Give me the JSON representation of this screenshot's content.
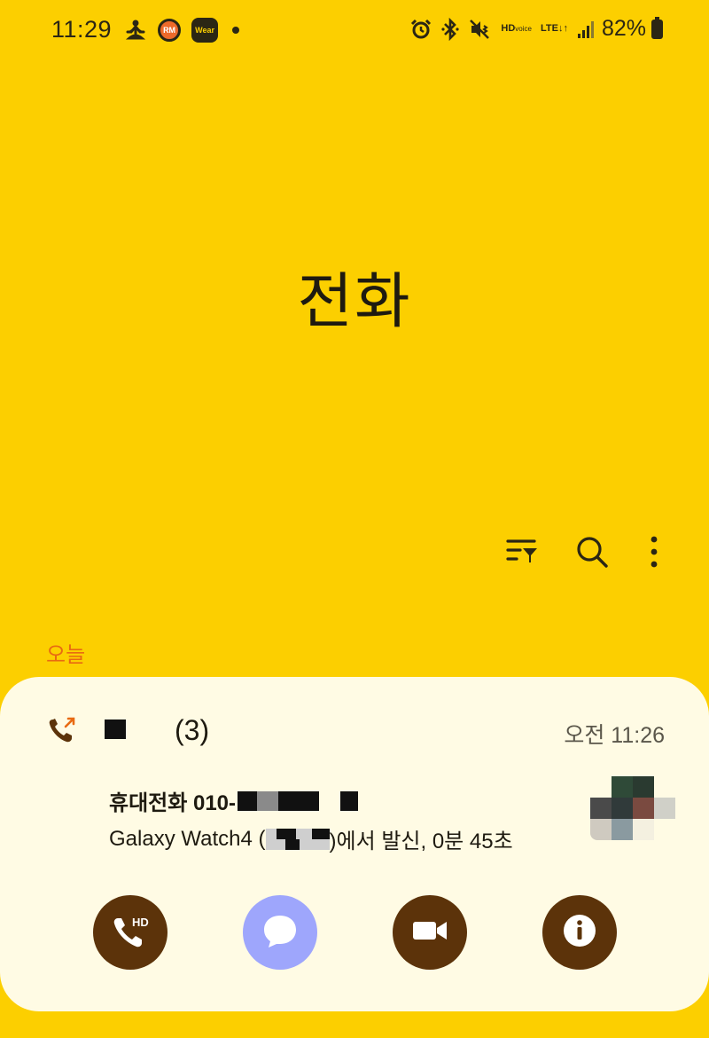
{
  "status_bar": {
    "time": "11:29",
    "left_icons": [
      "meditation-icon",
      "rm-app-icon",
      "wear-app-icon",
      "notification-dot"
    ],
    "rm_label": "RM",
    "wear_label": "Wear",
    "hd_label": "HD",
    "hd_sub": "voice",
    "lte_label": "LTE",
    "battery_percent": "82%",
    "right_icons": [
      "alarm-icon",
      "bluetooth-icon",
      "vibrate-icon",
      "hd-voice-icon",
      "lte-icon",
      "signal-icon",
      "battery-icon"
    ]
  },
  "header": {
    "title": "전화"
  },
  "toolbar": {
    "icons": [
      "filter-icon",
      "search-icon",
      "more-icon"
    ]
  },
  "section": {
    "label": "오늘"
  },
  "call_entry": {
    "count": "(3)",
    "time": "오전 11:26",
    "number_prefix": "휴대전화 010-",
    "device_prefix": "Galaxy Watch4 (",
    "device_suffix": ")에서 발신, 0분 45초"
  },
  "actions": {
    "icons": [
      "hd-call-icon",
      "message-icon",
      "video-call-icon",
      "info-icon"
    ],
    "hd_label": "HD"
  },
  "colors": {
    "background": "#FCCF00",
    "card": "#FFFBE4",
    "accent_orange": "#E86A12",
    "button_brown": "#5C330A",
    "button_lavender": "#9EA6FC"
  }
}
